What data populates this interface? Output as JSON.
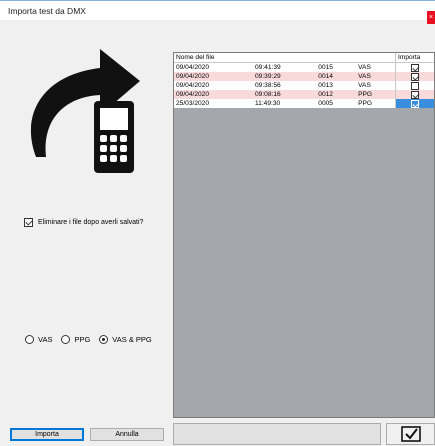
{
  "window": {
    "title": "Importa test da DMX",
    "close_glyph": "×"
  },
  "options": {
    "delete_label": "Eliminare i file dopo averli salvati?",
    "delete_checked": true,
    "radios": [
      {
        "label": "VAS",
        "selected": false
      },
      {
        "label": "PPG",
        "selected": false
      },
      {
        "label": "VAS & PPG",
        "selected": true
      }
    ]
  },
  "table": {
    "headers": {
      "name": "Nome del file",
      "import": "Importa"
    },
    "rows": [
      {
        "date": "09/04/2020",
        "time": "09:41:39",
        "num": "0015",
        "type": "VAS",
        "checked": true,
        "style": "white"
      },
      {
        "date": "09/04/2020",
        "time": "09:39:29",
        "num": "0014",
        "type": "VAS",
        "checked": true,
        "style": "pink"
      },
      {
        "date": "09/04/2020",
        "time": "09:38:56",
        "num": "0013",
        "type": "VAS",
        "checked": false,
        "style": "white"
      },
      {
        "date": "09/04/2020",
        "time": "09:08:16",
        "num": "0012",
        "type": "PPG",
        "checked": true,
        "style": "pink"
      },
      {
        "date": "25/03/2020",
        "time": "11:49:30",
        "num": "0005",
        "type": "PPG",
        "checked": true,
        "style": "white",
        "selected": true
      }
    ]
  },
  "buttons": {
    "import": "Importa",
    "cancel": "Annulla"
  },
  "icons": {
    "main": "import-device-arrow-icon",
    "confirm": "confirm-check-icon"
  },
  "colors": {
    "accent": "#0078d7",
    "pink_row": "#f8dadb",
    "grid_bg": "#a4a7ab",
    "close": "#e81123"
  }
}
